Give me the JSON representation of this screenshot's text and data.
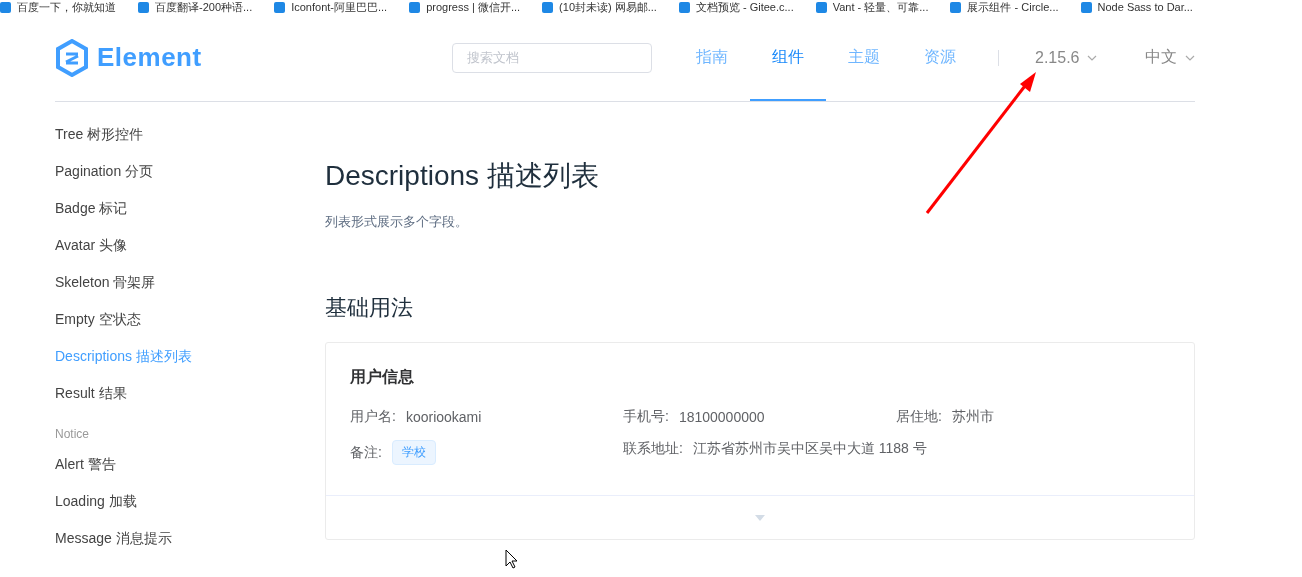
{
  "bookmarks": [
    "百度一下，你就知道",
    "百度翻译-200种语...",
    "Iconfont-阿里巴巴...",
    "progress | 微信开...",
    "(10封未读) 网易邮...",
    "文档预览 - Gitee.c...",
    "Vant - 轻量、可靠...",
    "展示组件 - Circle...",
    "Node Sass to Dar..."
  ],
  "header": {
    "logo": "Element",
    "search": {
      "placeholder": "搜索文档"
    },
    "nav": [
      {
        "label": "指南",
        "selected": false
      },
      {
        "label": "组件",
        "selected": true
      },
      {
        "label": "主题",
        "selected": false
      },
      {
        "label": "资源",
        "selected": false
      }
    ],
    "version": "2.15.6",
    "language": "中文"
  },
  "sidebar": {
    "items": [
      {
        "kind": "link",
        "label": "Tree 树形控件",
        "selected": false
      },
      {
        "kind": "link",
        "label": "Pagination 分页",
        "selected": false
      },
      {
        "kind": "link",
        "label": "Badge 标记",
        "selected": false
      },
      {
        "kind": "link",
        "label": "Avatar 头像",
        "selected": false
      },
      {
        "kind": "link",
        "label": "Skeleton 骨架屏",
        "selected": false
      },
      {
        "kind": "link",
        "label": "Empty 空状态",
        "selected": false
      },
      {
        "kind": "link",
        "label": "Descriptions 描述列表",
        "selected": true
      },
      {
        "kind": "link",
        "label": "Result 结果",
        "selected": false
      },
      {
        "kind": "group",
        "label": "Notice"
      },
      {
        "kind": "link",
        "label": "Alert 警告",
        "selected": false
      },
      {
        "kind": "link",
        "label": "Loading 加载",
        "selected": false
      },
      {
        "kind": "link",
        "label": "Message 消息提示",
        "selected": false
      }
    ]
  },
  "content": {
    "title": "Descriptions 描述列表",
    "subtitle": "列表形式展示多个字段。",
    "section": "基础用法",
    "card": {
      "title": "用户信息",
      "fields": [
        {
          "label": "用户名:",
          "value": "kooriookami",
          "kind": "text"
        },
        {
          "label": "手机号:",
          "value": "18100000000",
          "kind": "text"
        },
        {
          "label": "居住地:",
          "value": "苏州市",
          "kind": "text"
        },
        {
          "label": "备注:",
          "value": "学校",
          "kind": "tag"
        },
        {
          "label": "联系地址:",
          "value": "江苏省苏州市吴中区吴中大道 1188 号",
          "kind": "text"
        }
      ]
    }
  }
}
